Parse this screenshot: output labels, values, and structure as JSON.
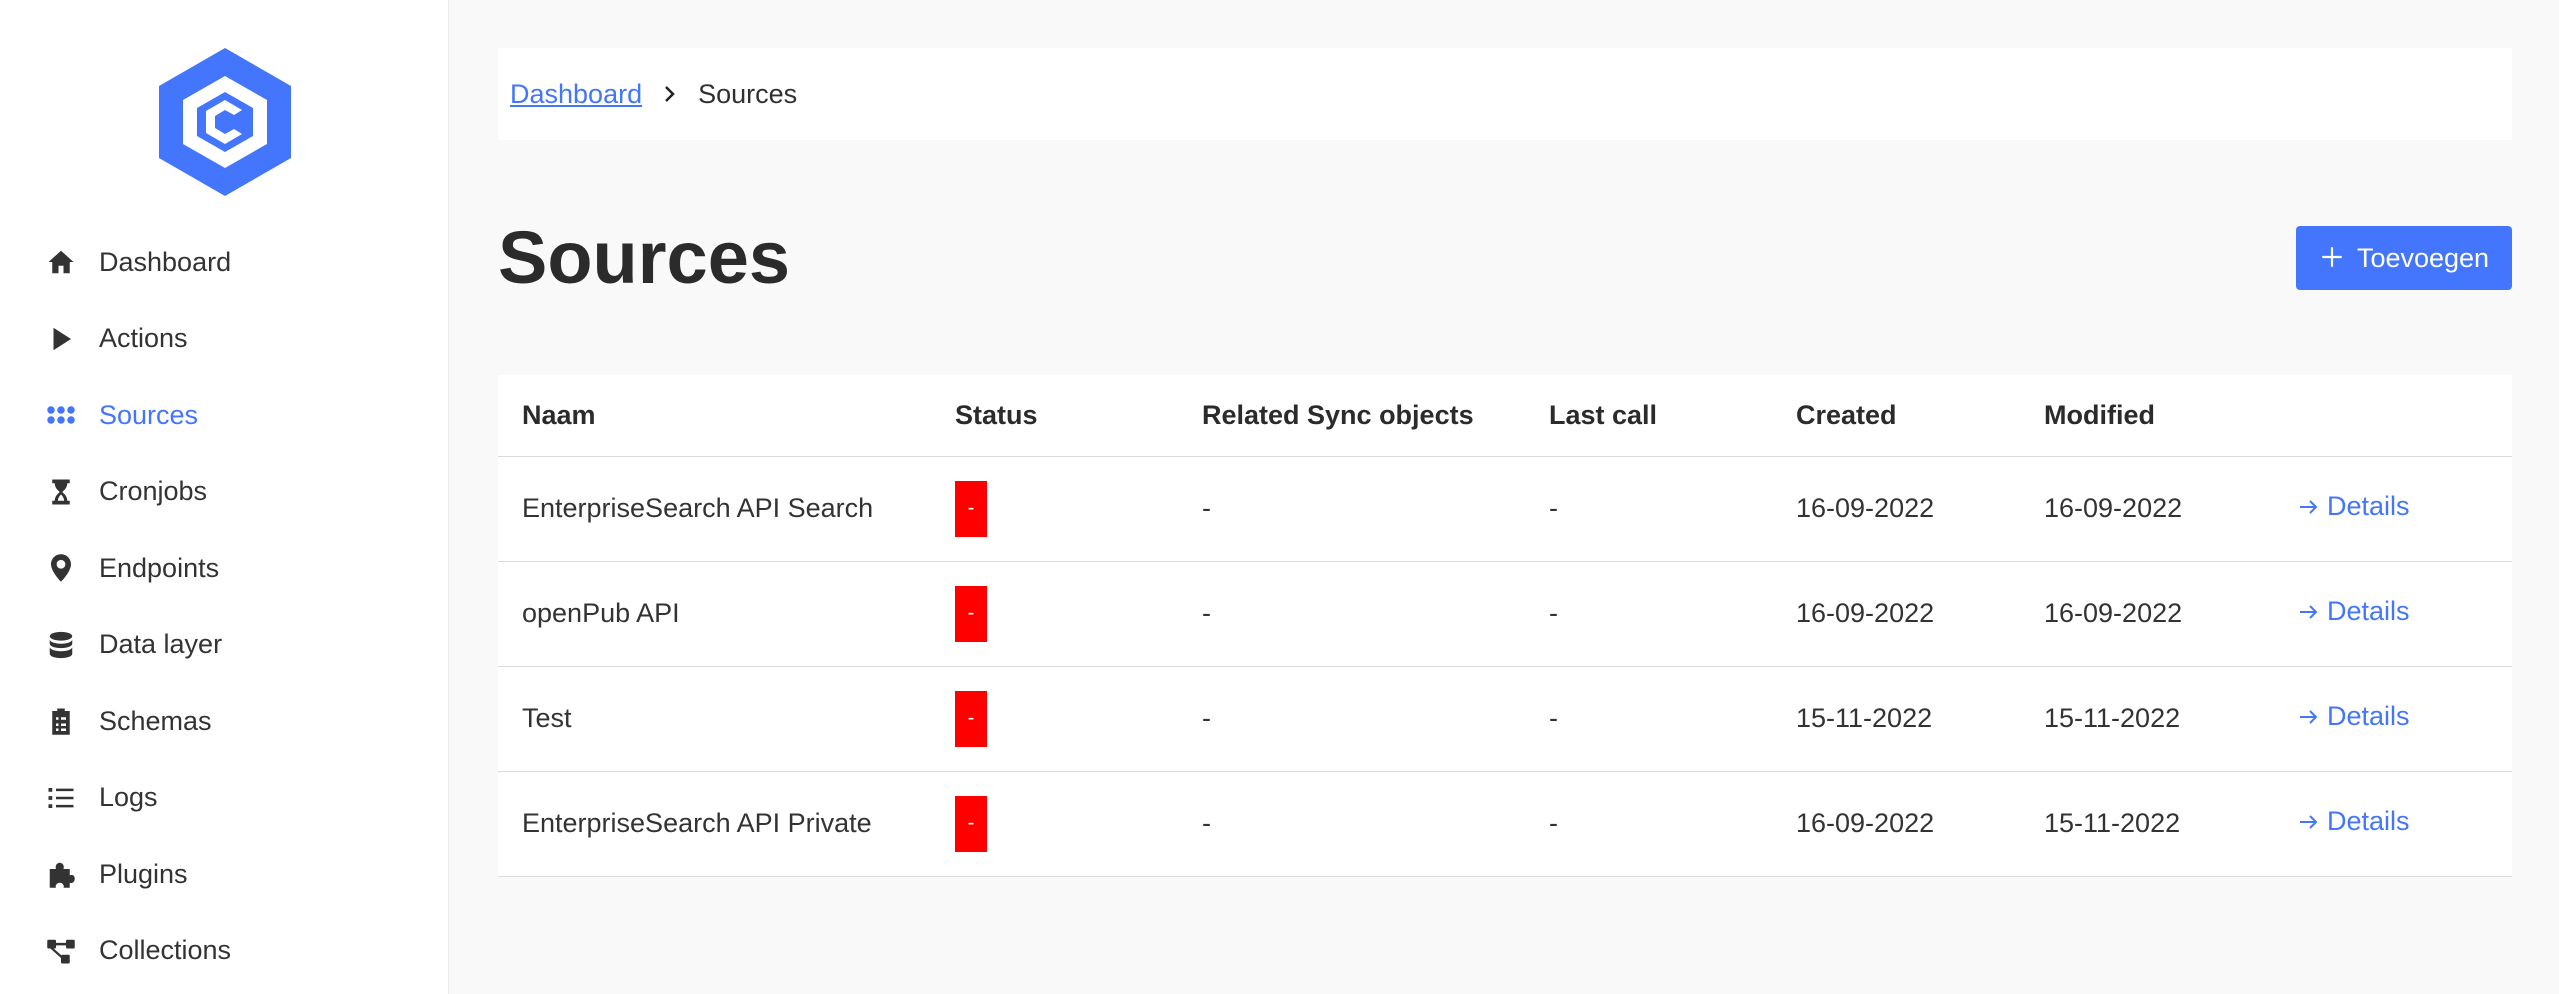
{
  "sidebar": {
    "logo": "c-hexagon-logo",
    "items": [
      {
        "label": "Dashboard",
        "icon": "home-icon"
      },
      {
        "label": "Actions",
        "icon": "play-icon"
      },
      {
        "label": "Sources",
        "icon": "grid-dots-icon",
        "active": true
      },
      {
        "label": "Cronjobs",
        "icon": "hourglass-icon"
      },
      {
        "label": "Endpoints",
        "icon": "location-pin-icon"
      },
      {
        "label": "Data layer",
        "icon": "database-icon"
      },
      {
        "label": "Schemas",
        "icon": "clipboard-icon"
      },
      {
        "label": "Logs",
        "icon": "list-icon"
      },
      {
        "label": "Plugins",
        "icon": "puzzle-icon"
      },
      {
        "label": "Collections",
        "icon": "nodes-icon"
      }
    ]
  },
  "breadcrumb": {
    "link": "Dashboard",
    "current": "Sources"
  },
  "page": {
    "title": "Sources",
    "add_label": "Toevoegen"
  },
  "table": {
    "headers": [
      "Naam",
      "Status",
      "Related Sync objects",
      "Last call",
      "Created",
      "Modified",
      ""
    ],
    "rows": [
      {
        "naam": "EnterpriseSearch API Search",
        "status": "-",
        "related": "-",
        "last_call": "-",
        "created": "16-09-2022",
        "modified": "16-09-2022",
        "action": "Details"
      },
      {
        "naam": "openPub API",
        "status": "-",
        "related": "-",
        "last_call": "-",
        "created": "16-09-2022",
        "modified": "16-09-2022",
        "action": "Details"
      },
      {
        "naam": "Test",
        "status": "-",
        "related": "-",
        "last_call": "-",
        "created": "15-11-2022",
        "modified": "15-11-2022",
        "action": "Details"
      },
      {
        "naam": "EnterpriseSearch API Private",
        "status": "-",
        "related": "-",
        "last_call": "-",
        "created": "16-09-2022",
        "modified": "15-11-2022",
        "action": "Details"
      }
    ]
  },
  "colors": {
    "accent": "#4376fc",
    "status_error": "#ff0000"
  }
}
